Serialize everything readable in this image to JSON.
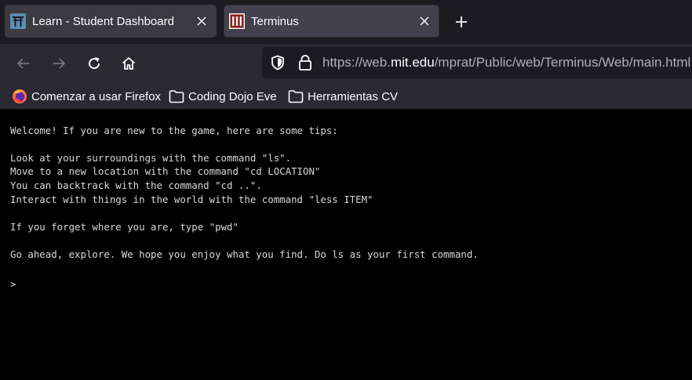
{
  "tabs": [
    {
      "label": "Learn - Student Dashboard",
      "icon": "torii-gate-icon",
      "active": false
    },
    {
      "label": "Terminus",
      "icon": "terminus-logo-icon",
      "active": true
    }
  ],
  "nav": {
    "url_prefix": "https://web.",
    "url_domain": "mit.edu",
    "url_path": "/mprat/Public/web/Terminus/Web/main.html"
  },
  "bookmarks": [
    {
      "label": "Comenzar a usar Firefox",
      "icon": "firefox-icon"
    },
    {
      "label": "Coding Dojo Eve",
      "icon": "folder-icon"
    },
    {
      "label": "Herramientas CV",
      "icon": "folder-icon"
    }
  ],
  "terminal": {
    "lines": [
      "Welcome! If you are new to the game, here are some tips:",
      "Look at your surroundings with the command \"ls\".",
      "Move to a new location with the command \"cd LOCATION\"",
      "You can backtrack with the command \"cd ..\".",
      "Interact with things in the world with the command \"less ITEM\"",
      "If you forget where you are, type \"pwd\"",
      "Go ahead, explore. We hope you enjoy what you find. Do ls as your first command.",
      ">"
    ]
  },
  "colors": {
    "accent": "#fbfbfe",
    "tab_active": "#42414d",
    "toolbar": "#2b2a33",
    "terminal_bg": "#000000",
    "terminal_text": "#d8d8d8"
  }
}
